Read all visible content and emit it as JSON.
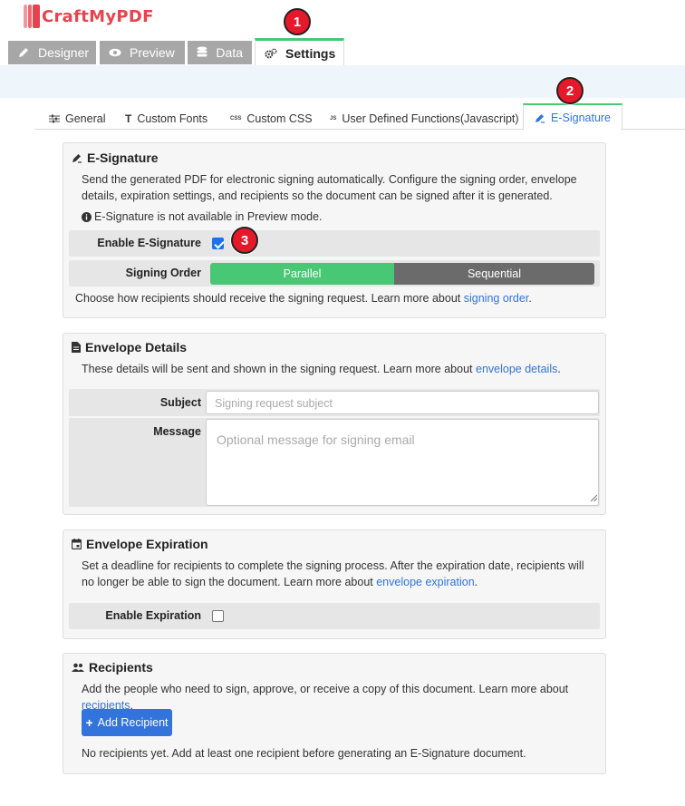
{
  "app": {
    "logo_text": "CraftMyPDF",
    "brand_color": "#e8424f",
    "accent_green": "#48c774",
    "link_blue": "#3273dc"
  },
  "main_tabs": [
    {
      "label": "Designer",
      "icon": "pencil-icon",
      "active": false
    },
    {
      "label": "Preview",
      "icon": "eye-icon",
      "active": false
    },
    {
      "label": "Data",
      "icon": "database-icon",
      "active": false
    },
    {
      "label": "Settings",
      "icon": "cogs-icon",
      "active": true
    }
  ],
  "sub_tabs": [
    {
      "label": "General",
      "icon": "sliders-icon",
      "active": false
    },
    {
      "label": "Custom Fonts",
      "icon": "font-icon",
      "active": false
    },
    {
      "label": "Custom CSS",
      "icon": "css-icon",
      "active": false
    },
    {
      "label": "User Defined Functions(Javascript)",
      "icon": "js-icon",
      "active": false
    },
    {
      "label": "E-Signature",
      "icon": "signature-icon",
      "active": true
    }
  ],
  "badges": [
    "1",
    "2",
    "3"
  ],
  "esign": {
    "title": "E-Signature",
    "desc": "Send the generated PDF for electronic signing automatically. Configure the signing order, envelope details, expiration settings, and recipients so the document can be signed after it is generated.",
    "notice": "E-Signature is not available in Preview mode.",
    "enable_label": "Enable E-Signature",
    "enable_checked": true,
    "order_label": "Signing Order",
    "order_options": [
      "Parallel",
      "Sequential"
    ],
    "order_selected": "Parallel",
    "order_help": "Choose how recipients should receive the signing request. Learn more about ",
    "order_help_link": "signing order",
    "order_help_end": "."
  },
  "envelope": {
    "title": "Envelope Details",
    "desc": "These details will be sent and shown in the signing request. Learn more about ",
    "desc_link": "envelope details",
    "desc_end": ".",
    "subject_label": "Subject",
    "subject_placeholder": "Signing request subject",
    "subject_value": "",
    "message_label": "Message",
    "message_placeholder": "Optional message for signing email",
    "message_value": ""
  },
  "expiration": {
    "title": "Envelope Expiration",
    "desc": "Set a deadline for recipients to complete the signing process. After the expiration date, recipients will no longer be able to sign the document. Learn more about ",
    "desc_link": "envelope expiration",
    "desc_end": ".",
    "enable_label": "Enable Expiration",
    "enable_checked": false
  },
  "recipients": {
    "title": "Recipients",
    "desc": "Add the people who need to sign, approve, or receive a copy of this document. Learn more about ",
    "desc_link": "recipients",
    "desc_end": ".",
    "add_button": "Add Recipient",
    "empty_text": "No recipients yet. Add at least one recipient before generating an E-Signature document."
  }
}
